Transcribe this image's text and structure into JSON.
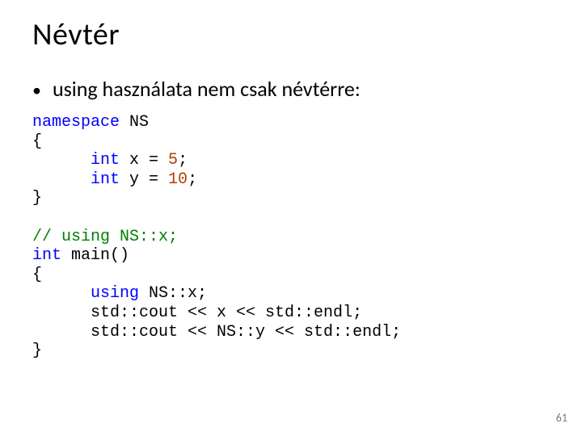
{
  "title": "Névtér",
  "bullet_text": "using használata nem csak névtérre:",
  "code": {
    "l1_kw": "namespace",
    "l1_rest": " NS",
    "l2": "{",
    "l3_indent": "      ",
    "l3_kw": "int",
    "l3_mid": " x = ",
    "l3_num": "5",
    "l3_end": ";",
    "l4_indent": "      ",
    "l4_kw": "int",
    "l4_mid": " y = ",
    "l4_num": "10",
    "l4_end": ";",
    "l5": "}",
    "l7_cmt": "// using NS::x;",
    "l8_kw": "int",
    "l8_rest": " main()",
    "l9": "{",
    "l10_indent": "      ",
    "l10_kw": "using",
    "l10_rest": " NS::x;",
    "l11": "      std::cout << x << std::endl;",
    "l12": "      std::cout << NS::y << std::endl;",
    "l13": "}"
  },
  "page_number": "61"
}
